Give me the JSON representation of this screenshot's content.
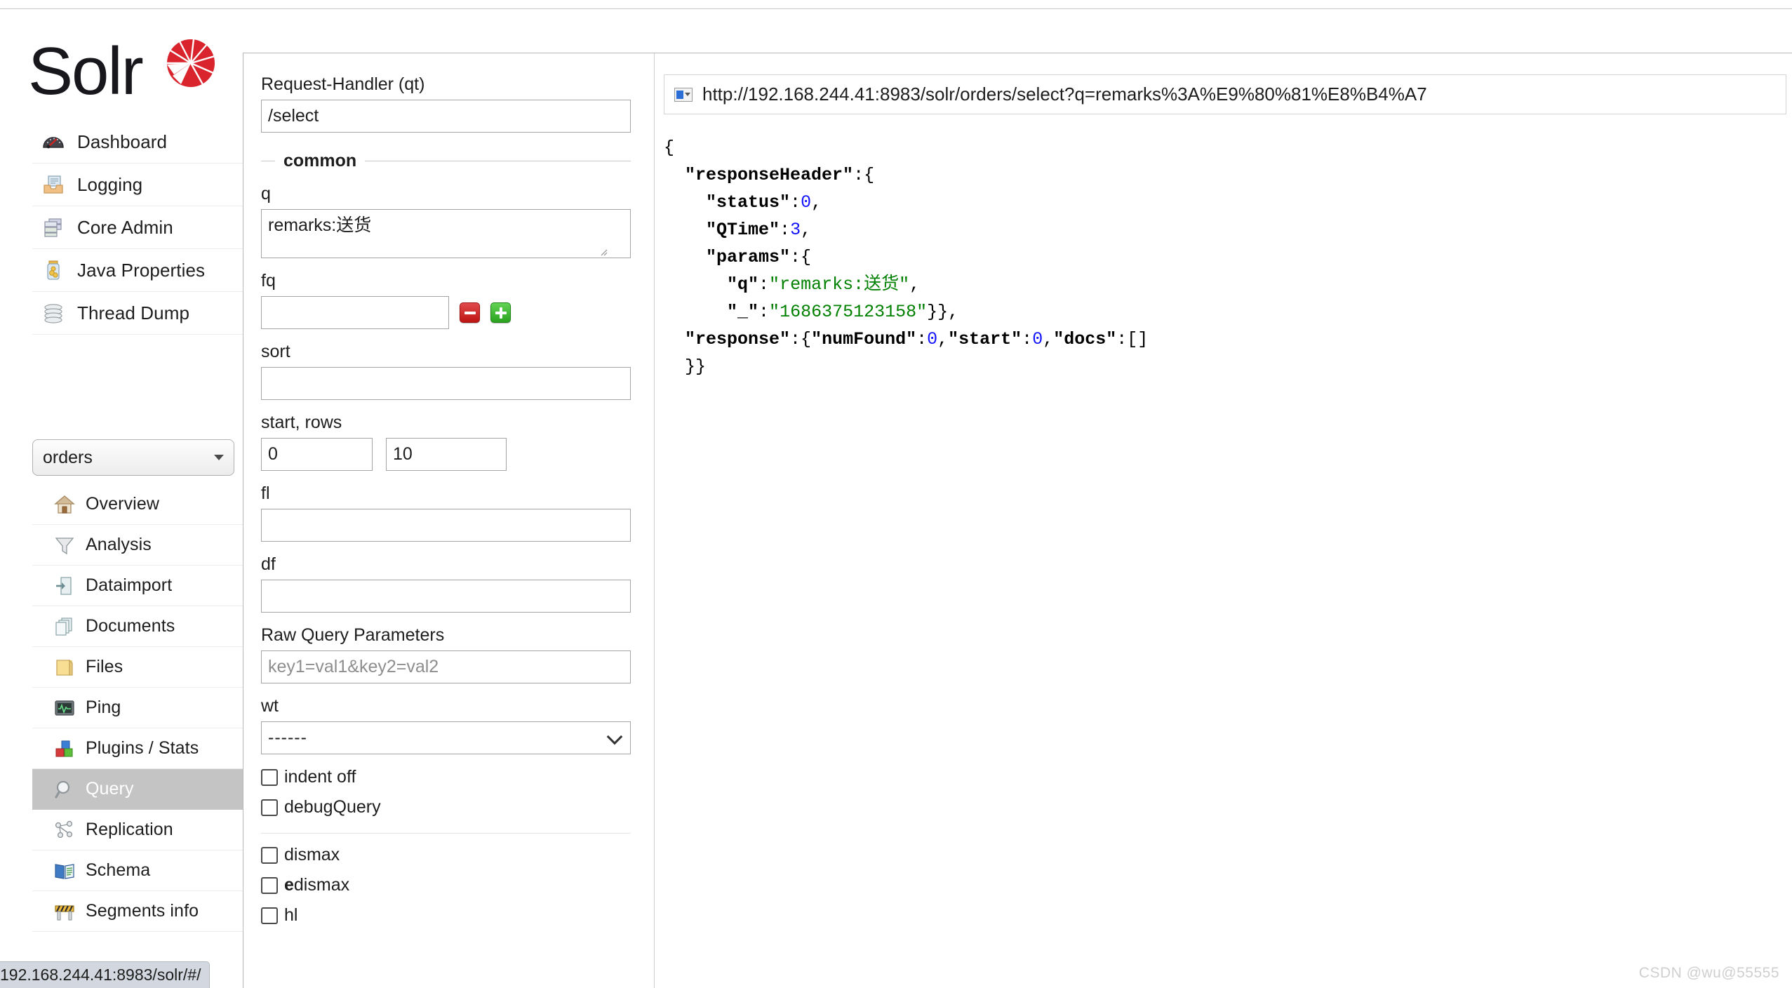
{
  "brand": {
    "name": "Solr",
    "logo_color": "#d9232d"
  },
  "sidebar": {
    "main_items": [
      {
        "label": "Dashboard",
        "icon": "dashboard-gauge-icon"
      },
      {
        "label": "Logging",
        "icon": "logging-tray-icon"
      },
      {
        "label": "Core Admin",
        "icon": "core-admin-servers-icon"
      },
      {
        "label": "Java Properties",
        "icon": "java-properties-jar-icon"
      },
      {
        "label": "Thread Dump",
        "icon": "thread-dump-stack-icon"
      }
    ],
    "core_selector": {
      "value": "orders",
      "caret": "chevron-down-icon"
    },
    "core_items": [
      {
        "label": "Overview",
        "icon": "overview-house-icon",
        "active": false
      },
      {
        "label": "Analysis",
        "icon": "analysis-funnel-icon",
        "active": false
      },
      {
        "label": "Dataimport",
        "icon": "dataimport-page-icon",
        "active": false
      },
      {
        "label": "Documents",
        "icon": "documents-pages-icon",
        "active": false
      },
      {
        "label": "Files",
        "icon": "files-folder-icon",
        "active": false
      },
      {
        "label": "Ping",
        "icon": "ping-monitor-icon",
        "active": false
      },
      {
        "label": "Plugins / Stats",
        "icon": "plugins-blocks-icon",
        "active": false
      },
      {
        "label": "Query",
        "icon": "query-magnifier-icon",
        "active": true
      },
      {
        "label": "Replication",
        "icon": "replication-nodes-icon",
        "active": false
      },
      {
        "label": "Schema",
        "icon": "schema-book-icon",
        "active": false
      },
      {
        "label": "Segments info",
        "icon": "segments-barrier-icon",
        "active": false
      }
    ]
  },
  "query_form": {
    "request_handler": {
      "label": "Request-Handler (qt)",
      "value": "/select"
    },
    "common_legend": "common",
    "q": {
      "label": "q",
      "value": "remarks:送货"
    },
    "fq": {
      "label": "fq",
      "value": "",
      "remove_button": "minus-icon",
      "add_button": "plus-icon"
    },
    "sort": {
      "label": "sort",
      "value": ""
    },
    "start_rows": {
      "label": "start, rows",
      "start": "0",
      "rows": "10"
    },
    "fl": {
      "label": "fl",
      "value": ""
    },
    "df": {
      "label": "df",
      "value": ""
    },
    "raw_query_parameters": {
      "label": "Raw Query Parameters",
      "value": "",
      "placeholder": "key1=val1&key2=val2"
    },
    "wt": {
      "label": "wt",
      "value": "------"
    },
    "checkboxes": [
      {
        "label": "indent off",
        "checked": false
      },
      {
        "label": "debugQuery",
        "checked": false
      }
    ],
    "parser_checkboxes": [
      {
        "label_plain": "",
        "label_bold": "",
        "label": "dismax",
        "checked": false
      },
      {
        "label": "edismax",
        "bold_prefix": "e",
        "rest": "dismax",
        "checked": false
      },
      {
        "label": "hl",
        "checked": false
      }
    ]
  },
  "result": {
    "url_icon": "url-favicon-icon",
    "url": "http://192.168.244.41:8983/solr/orders/select?q=remarks%3A%E9%80%81%E8%B4%A7",
    "response_json": {
      "responseHeader": {
        "status": 0,
        "QTime": 3,
        "params": {
          "q": "remarks:送货",
          "_": "1686375123158"
        }
      },
      "response": {
        "numFound": 0,
        "start": 0,
        "docs": []
      }
    }
  },
  "statusbar": {
    "text": "192.168.244.41:8983/solr/#/"
  },
  "watermark": {
    "text": "CSDN @wu@55555"
  }
}
